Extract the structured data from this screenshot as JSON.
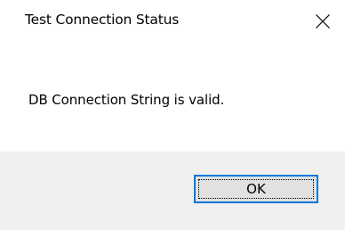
{
  "dialog": {
    "title": "Test Connection Status",
    "close_icon": "close-icon",
    "message": "DB Connection String is valid.",
    "ok_label": "OK"
  },
  "colors": {
    "footer_background": "#f0f0f0",
    "button_background": "#e1e1e1",
    "button_focus_border": "#0078d7"
  }
}
